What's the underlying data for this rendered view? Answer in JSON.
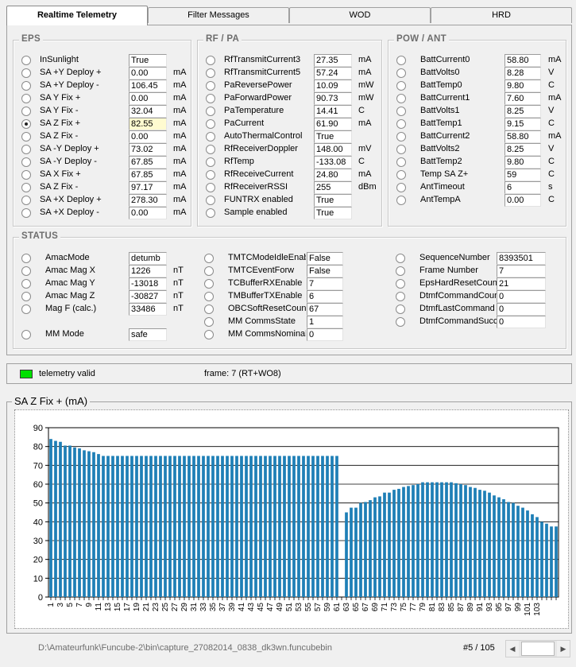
{
  "tabs": [
    {
      "label": "Realtime Telemetry",
      "active": true
    },
    {
      "label": "Filter Messages",
      "active": false
    },
    {
      "label": "WOD",
      "active": false
    },
    {
      "label": "HRD",
      "active": false
    }
  ],
  "eps": {
    "title": "EPS",
    "rows": [
      {
        "label": "InSunlight",
        "value": "True",
        "unit": ""
      },
      {
        "label": "SA +Y Deploy +",
        "value": "0.00",
        "unit": "mA"
      },
      {
        "label": "SA +Y Deploy -",
        "value": "106.45",
        "unit": "mA"
      },
      {
        "label": "SA Y Fix +",
        "value": "0.00",
        "unit": "mA"
      },
      {
        "label": "SA Y Fix -",
        "value": "32.04",
        "unit": "mA"
      },
      {
        "label": "SA Z Fix +",
        "value": "82.55",
        "unit": "mA",
        "selected": true
      },
      {
        "label": "SA Z Fix -",
        "value": "0.00",
        "unit": "mA"
      },
      {
        "label": "SA -Y Deploy +",
        "value": "73.02",
        "unit": "mA"
      },
      {
        "label": "SA -Y Deploy -",
        "value": "67.85",
        "unit": "mA"
      },
      {
        "label": "SA X Fix +",
        "value": "67.85",
        "unit": "mA"
      },
      {
        "label": "SA Z Fix -",
        "value": "97.17",
        "unit": "mA"
      },
      {
        "label": "SA +X Deploy +",
        "value": "278.30",
        "unit": "mA"
      },
      {
        "label": "SA +X Deploy -",
        "value": "0.00",
        "unit": "mA"
      }
    ]
  },
  "rfpa": {
    "title": "RF / PA",
    "rows": [
      {
        "label": "RfTransmitCurrent3",
        "value": "27.35",
        "unit": "mA"
      },
      {
        "label": "RfTransmitCurrent5",
        "value": "57.24",
        "unit": "mA"
      },
      {
        "label": "PaReversePower",
        "value": "10.09",
        "unit": "mW"
      },
      {
        "label": "PaForwardPower",
        "value": "90.73",
        "unit": "mW"
      },
      {
        "label": "PaTemperature",
        "value": "14.41",
        "unit": "C"
      },
      {
        "label": "PaCurrent",
        "value": "61.90",
        "unit": "mA"
      },
      {
        "label": "AutoThermalControl",
        "value": "True",
        "unit": ""
      },
      {
        "label": "RfReceiverDoppler",
        "value": "148.00",
        "unit": "mV"
      },
      {
        "label": "RfTemp",
        "value": "-133.08",
        "unit": "C"
      },
      {
        "label": "RfReceiveCurrent",
        "value": "24.80",
        "unit": "mA"
      },
      {
        "label": "RfReceiverRSSI",
        "value": "255",
        "unit": "dBm"
      },
      {
        "label": "FUNTRX enabled",
        "value": "True",
        "unit": ""
      },
      {
        "label": "Sample enabled",
        "value": "True",
        "unit": ""
      }
    ]
  },
  "powant": {
    "title": "POW / ANT",
    "rows": [
      {
        "label": "BattCurrent0",
        "value": "58.80",
        "unit": "mA"
      },
      {
        "label": "BattVolts0",
        "value": "8.28",
        "unit": "V"
      },
      {
        "label": "BattTemp0",
        "value": "9.80",
        "unit": "C"
      },
      {
        "label": "BattCurrent1",
        "value": "7.60",
        "unit": "mA"
      },
      {
        "label": "BattVolts1",
        "value": "8.25",
        "unit": "V"
      },
      {
        "label": "BattTemp1",
        "value": "9.15",
        "unit": "C"
      },
      {
        "label": "BattCurrent2",
        "value": "58.80",
        "unit": "mA"
      },
      {
        "label": "BattVolts2",
        "value": "8.25",
        "unit": "V"
      },
      {
        "label": "BattTemp2",
        "value": "9.80",
        "unit": "C"
      },
      {
        "label": "Temp SA Z+",
        "value": "59",
        "unit": "C"
      },
      {
        "label": "AntTimeout",
        "value": "6",
        "unit": "s"
      },
      {
        "label": "AntTempA",
        "value": "0.00",
        "unit": "C"
      }
    ]
  },
  "status": {
    "title": "STATUS",
    "col1": [
      {
        "label": "AmacMode",
        "value": "detumb",
        "unit": ""
      },
      {
        "label": "Amac Mag X",
        "value": "1226",
        "unit": "nT"
      },
      {
        "label": "Amac Mag Y",
        "value": "-13018",
        "unit": "nT"
      },
      {
        "label": "Amac Mag Z",
        "value": "-30827",
        "unit": "nT"
      },
      {
        "label": "Mag F (calc.)",
        "value": "33486",
        "unit": "nT"
      },
      {
        "label": "MM Mode",
        "value": "safe",
        "unit": ""
      }
    ],
    "col2": [
      {
        "label": "TMTCModeIdleEnab",
        "value": "False",
        "unit": ""
      },
      {
        "label": "TMTCEventForw",
        "value": "False",
        "unit": ""
      },
      {
        "label": "TCBufferRXEnable",
        "value": "7",
        "unit": ""
      },
      {
        "label": "TMBufferTXEnable",
        "value": "6",
        "unit": ""
      },
      {
        "label": "OBCSoftResetCount",
        "value": "67",
        "unit": ""
      },
      {
        "label": "MM CommsState",
        "value": "1",
        "unit": ""
      },
      {
        "label": "MM CommsNominal",
        "value": "0",
        "unit": ""
      }
    ],
    "col3": [
      {
        "label": "SequenceNumber",
        "value": "8393501",
        "unit": ""
      },
      {
        "label": "Frame Number",
        "value": "7",
        "unit": ""
      },
      {
        "label": "EpsHardResetCount",
        "value": "21",
        "unit": ""
      },
      {
        "label": "DtmfCommandCount",
        "value": "0",
        "unit": ""
      },
      {
        "label": "DtmfLastCommand",
        "value": "0",
        "unit": ""
      },
      {
        "label": "DtmfCommandSucce",
        "value": "0",
        "unit": ""
      }
    ]
  },
  "status_strip": {
    "valid_label": "telemetry valid",
    "frame_label": "frame: 7 (RT+WO8)",
    "led_color": "#00e000"
  },
  "chart_data": {
    "type": "bar",
    "title": "SA Z Fix + (mA)",
    "bar_color": "#1e7fb6",
    "ylim": [
      0,
      90
    ],
    "yticks": [
      0,
      10,
      20,
      30,
      40,
      50,
      60,
      70,
      80,
      90
    ],
    "grid": true,
    "xlabel_step": 2,
    "x": [
      1,
      2,
      3,
      4,
      5,
      6,
      7,
      8,
      9,
      10,
      11,
      12,
      13,
      14,
      15,
      16,
      17,
      18,
      19,
      20,
      21,
      22,
      23,
      24,
      25,
      26,
      27,
      28,
      29,
      30,
      31,
      32,
      33,
      34,
      35,
      36,
      37,
      38,
      39,
      40,
      41,
      42,
      43,
      44,
      45,
      46,
      47,
      48,
      49,
      50,
      51,
      52,
      53,
      54,
      55,
      56,
      57,
      58,
      59,
      60,
      61,
      62,
      63,
      64,
      65,
      66,
      67,
      68,
      69,
      70,
      71,
      72,
      73,
      74,
      75,
      76,
      77,
      78,
      79,
      80,
      81,
      82,
      83,
      84,
      85,
      86,
      87,
      88,
      89,
      90,
      91,
      92,
      93,
      94,
      95,
      96,
      97,
      98,
      99,
      100,
      101,
      102,
      103,
      104
    ],
    "values": [
      84,
      83,
      82.5,
      80.5,
      80.5,
      79.5,
      79,
      78,
      77.5,
      77,
      76,
      75,
      75,
      75,
      75,
      75,
      75,
      75,
      75,
      75,
      75,
      75,
      75,
      75,
      75,
      75,
      75,
      75,
      75,
      75,
      75,
      75,
      75,
      75,
      75,
      75,
      75,
      75,
      75,
      75,
      75,
      75,
      75,
      75,
      75,
      75,
      75,
      75,
      75,
      75,
      75,
      75,
      75,
      75,
      75,
      75,
      75,
      75,
      75,
      75,
      75,
      0,
      45,
      47.5,
      47.5,
      50,
      50.5,
      51.5,
      53,
      53.5,
      55.5,
      55.5,
      57,
      57.5,
      58.5,
      59,
      59.5,
      60,
      61,
      61,
      61,
      61,
      61,
      61,
      61,
      60.5,
      60,
      59.5,
      58.5,
      58,
      57,
      56.5,
      55.5,
      54,
      53,
      52,
      50.5,
      50,
      48.5,
      47.5,
      46,
      44,
      42.5,
      40,
      39,
      37.5,
      37.5
    ]
  },
  "bottom": {
    "file_path": "D:\\Amateurfunk\\Funcube-2\\bin\\capture_27082014_0838_dk3wn.funcubebin",
    "page_counter": "#5 / 105"
  }
}
